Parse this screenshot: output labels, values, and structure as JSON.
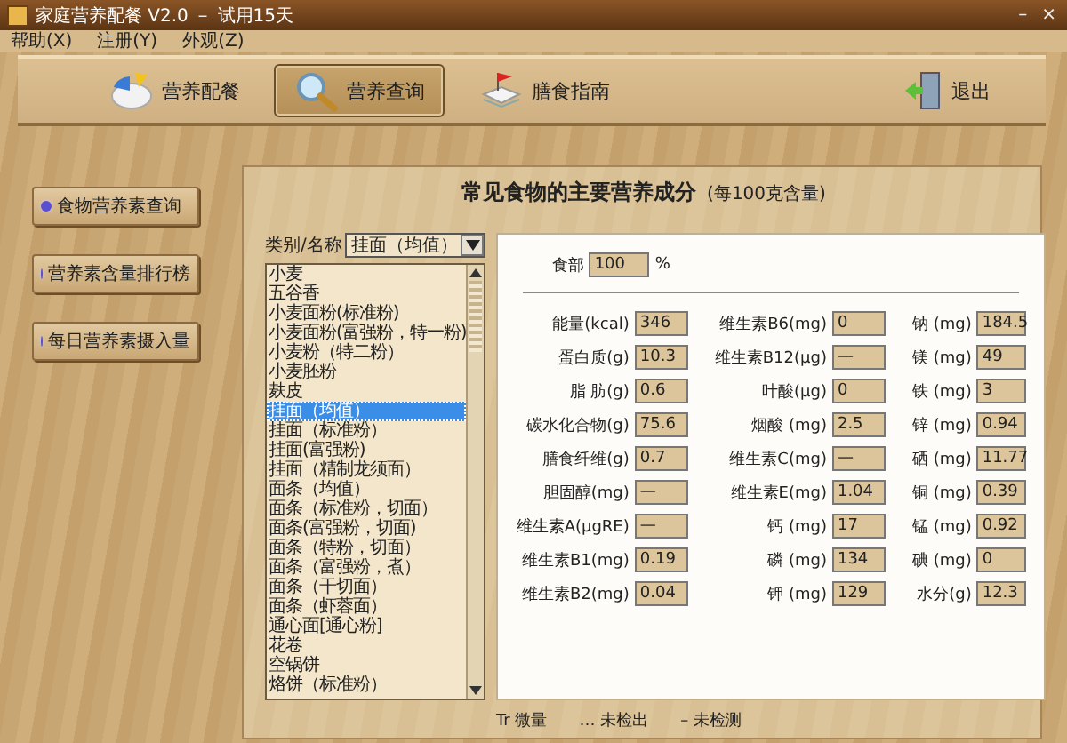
{
  "window": {
    "title": "家庭营养配餐 V2.0 － 试用15天",
    "controls": [
      "–",
      "×"
    ]
  },
  "menu": [
    "帮助(X)",
    "注册(Y)",
    "外观(Z)"
  ],
  "toolbar": [
    {
      "label": "营养配餐",
      "selected": false
    },
    {
      "label": "营养查询",
      "selected": true
    },
    {
      "label": "膳食指南",
      "selected": false
    }
  ],
  "exit": {
    "label": "退出"
  },
  "side_buttons": [
    "食物营养素查询",
    "营养素含量排行榜",
    "每日营养素摄入量"
  ],
  "panel": {
    "title": "常见食物的主要营养成分",
    "subtitle": "(每100克含量)"
  },
  "category": {
    "label": "类别/名称",
    "value": "挂面（均值）"
  },
  "foods": [
    {
      "name": "小麦",
      "selected": false
    },
    {
      "name": "五谷香",
      "selected": false
    },
    {
      "name": "小麦面粉(标准粉)",
      "selected": false
    },
    {
      "name": "小麦面粉(富强粉，特一粉)",
      "selected": false
    },
    {
      "name": "小麦粉（特二粉）",
      "selected": false
    },
    {
      "name": "小麦胚粉",
      "selected": false
    },
    {
      "name": "麸皮",
      "selected": false
    },
    {
      "name": "挂面（均值）",
      "selected": true
    },
    {
      "name": "挂面（标准粉）",
      "selected": false
    },
    {
      "name": "挂面(富强粉)",
      "selected": false
    },
    {
      "name": "挂面（精制龙须面）",
      "selected": false
    },
    {
      "name": "面条（均值）",
      "selected": false
    },
    {
      "name": "面条（标准粉，切面）",
      "selected": false
    },
    {
      "name": "面条(富强粉，切面)",
      "selected": false
    },
    {
      "name": "面条（特粉，切面）",
      "selected": false
    },
    {
      "name": "面条（富强粉，煮）",
      "selected": false
    },
    {
      "name": "面条（干切面）",
      "selected": false
    },
    {
      "name": "面条（虾蓉面）",
      "selected": false
    },
    {
      "name": "通心面[通心粉]",
      "selected": false
    },
    {
      "name": "花卷",
      "selected": false
    },
    {
      "name": "空锅饼",
      "selected": false
    },
    {
      "name": "烙饼（标准粉）",
      "selected": false
    }
  ],
  "edible": {
    "label": "食部",
    "value": "100",
    "unit": "%"
  },
  "nutrients": [
    [
      {
        "label": "能量(kcal)",
        "value": "346"
      },
      {
        "label": "维生素B6(mg)",
        "value": "0"
      },
      {
        "label": "钠 (mg)",
        "value": "184.5"
      }
    ],
    [
      {
        "label": "蛋白质(g)",
        "value": "10.3"
      },
      {
        "label": "维生素B12(μg)",
        "value": "—"
      },
      {
        "label": "镁 (mg)",
        "value": "49"
      }
    ],
    [
      {
        "label": "脂 肪(g)",
        "value": "0.6"
      },
      {
        "label": "叶酸(μg)",
        "value": "0"
      },
      {
        "label": "铁 (mg)",
        "value": "3"
      }
    ],
    [
      {
        "label": "碳水化合物(g)",
        "value": "75.6"
      },
      {
        "label": "烟酸 (mg)",
        "value": "2.5"
      },
      {
        "label": "锌 (mg)",
        "value": "0.94"
      }
    ],
    [
      {
        "label": "膳食纤维(g)",
        "value": "0.7"
      },
      {
        "label": "维生素C(mg)",
        "value": "—"
      },
      {
        "label": "硒 (mg)",
        "value": "11.77"
      }
    ],
    [
      {
        "label": "胆固醇(mg)",
        "value": "—"
      },
      {
        "label": "维生素E(mg)",
        "value": "1.04"
      },
      {
        "label": "铜 (mg)",
        "value": "0.39"
      }
    ],
    [
      {
        "label": "维生素A(μgRE)",
        "value": "—"
      },
      {
        "label": "钙 (mg)",
        "value": "17"
      },
      {
        "label": "锰 (mg)",
        "value": "0.92"
      }
    ],
    [
      {
        "label": "维生素B1(mg)",
        "value": "0.19"
      },
      {
        "label": "磷 (mg)",
        "value": "134"
      },
      {
        "label": "碘 (mg)",
        "value": "0"
      }
    ],
    [
      {
        "label": "维生素B2(mg)",
        "value": "0.04"
      },
      {
        "label": "钾 (mg)",
        "value": "129"
      },
      {
        "label": "水分(g)",
        "value": "12.3"
      }
    ]
  ],
  "legend": [
    "Tr 微量",
    "… 未检出",
    "– 未检测"
  ]
}
